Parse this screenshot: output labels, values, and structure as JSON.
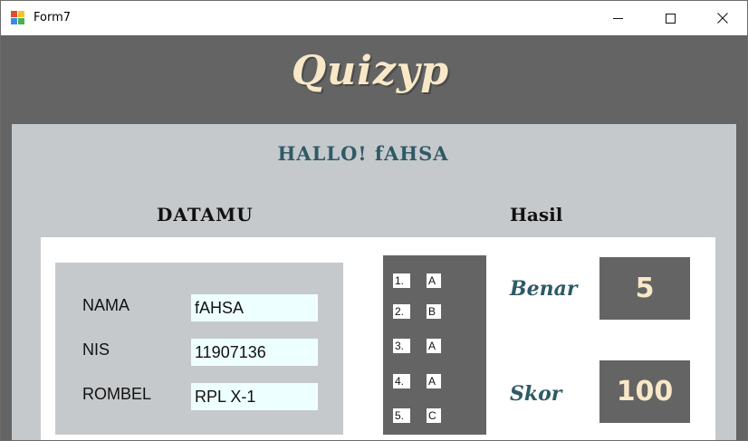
{
  "window": {
    "title": "Form7",
    "icon": "windows-form-icon",
    "controls": [
      "minimize-icon",
      "maximize-icon",
      "close-icon"
    ]
  },
  "header": {
    "logo_text": "Quizyp"
  },
  "main": {
    "greeting": "HALLO! fAHSA",
    "datamu_title": "DATAMU",
    "hasil_title": "Hasil",
    "fields": {
      "nama": {
        "label": "NAMA",
        "value": "fAHSA"
      },
      "nis": {
        "label": "NIS",
        "value": "11907136"
      },
      "rombel": {
        "label": "ROMBEL",
        "value": "RPL X-1"
      }
    },
    "answers": [
      {
        "num": "1.",
        "letter": "A"
      },
      {
        "num": "2.",
        "letter": "B"
      },
      {
        "num": "3.",
        "letter": "A"
      },
      {
        "num": "4.",
        "letter": "A"
      },
      {
        "num": "5.",
        "letter": "C"
      }
    ],
    "results": {
      "benar_label": "Benar",
      "benar_value": "5",
      "skor_label": "Skor",
      "skor_value": "100"
    }
  },
  "colors": {
    "dark_gray": "#646464",
    "panel_gray": "#c6c9cc",
    "teal_text": "#2e5a66",
    "cream_text": "#f8e8c8",
    "input_bg": "#eeffff"
  }
}
